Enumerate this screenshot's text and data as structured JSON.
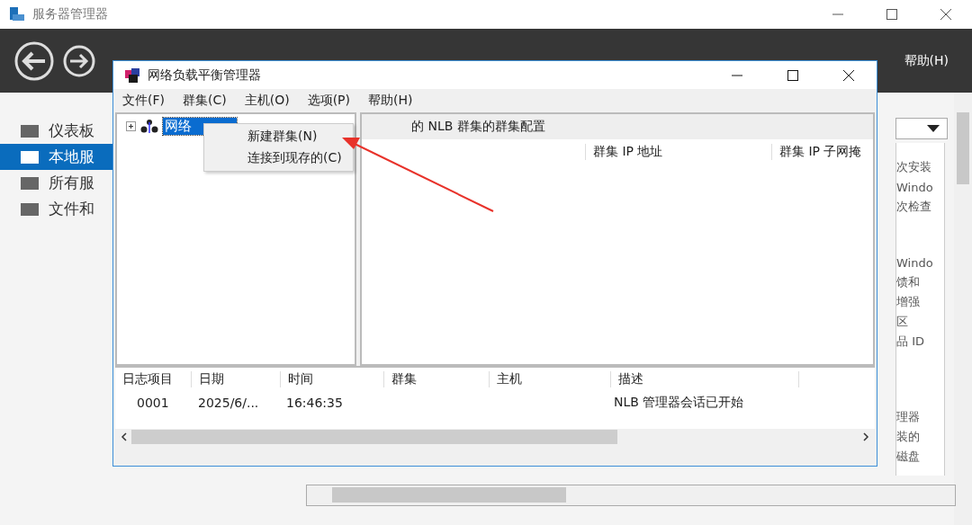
{
  "window": {
    "title": "服务器管理器"
  },
  "header": {
    "menu": [
      "帮助(H)"
    ]
  },
  "sidebar": {
    "items": [
      {
        "label": "仪表板",
        "selected": false
      },
      {
        "label": "本地服",
        "selected": true
      },
      {
        "label": "所有服",
        "selected": false
      },
      {
        "label": "文件和",
        "selected": false
      }
    ]
  },
  "properties_panel": {
    "groups": [
      [
        "次安装",
        "Windo",
        "次检查"
      ],
      [
        "Windo",
        "馈和",
        "增强",
        "区",
        "品 ID"
      ],
      [
        "理器",
        "装的",
        "磁盘"
      ]
    ]
  },
  "nlb_window": {
    "title": "网络负载平衡管理器",
    "menu": [
      "文件(F)",
      "群集(C)",
      "主机(O)",
      "选项(P)",
      "帮助(H)"
    ],
    "tree": [
      {
        "label": "网络",
        "selected": true,
        "expanded": false
      }
    ],
    "context_menu": [
      "新建群集(N)",
      "连接到现存的(C)"
    ],
    "details": {
      "heading": "的 NLB 群集的群集配置",
      "columns": [
        "群集 IP 地址",
        "群集 IP 子网掩"
      ]
    },
    "log": {
      "columns": [
        "日志项目",
        "日期",
        "时间",
        "群集",
        "主机",
        "描述"
      ],
      "rows": [
        {
          "cells": [
            "0001",
            "2025/6/...",
            "16:46:35"
          ],
          "description": "NLB 管理器会话已开始"
        }
      ]
    }
  }
}
